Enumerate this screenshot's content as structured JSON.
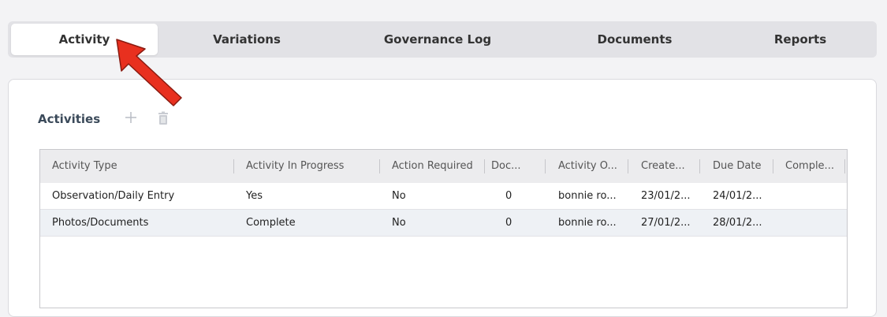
{
  "tabs": [
    {
      "label": "Activity",
      "active": true
    },
    {
      "label": "Variations"
    },
    {
      "label": "Governance Log"
    },
    {
      "label": "Documents"
    },
    {
      "label": "Reports"
    }
  ],
  "section": {
    "title": "Activities",
    "add_icon": "plus-icon",
    "delete_icon": "trash-icon"
  },
  "table": {
    "columns": [
      "Activity Type",
      "Activity In Progress",
      "Action Required",
      "Doc...",
      "Activity O...",
      "Create...",
      "Due Date",
      "Comple..."
    ],
    "rows": [
      [
        "Observation/Daily Entry",
        "Yes",
        "No",
        "0",
        "bonnie ro...",
        "23/01/2...",
        "24/01/2...",
        ""
      ],
      [
        "Photos/Documents",
        "Complete",
        "No",
        "0",
        "bonnie ro...",
        "27/01/2...",
        "28/01/2...",
        ""
      ]
    ]
  },
  "colors": {
    "arrow": "#e8301f",
    "accent_bg": "#e2e2e6"
  }
}
